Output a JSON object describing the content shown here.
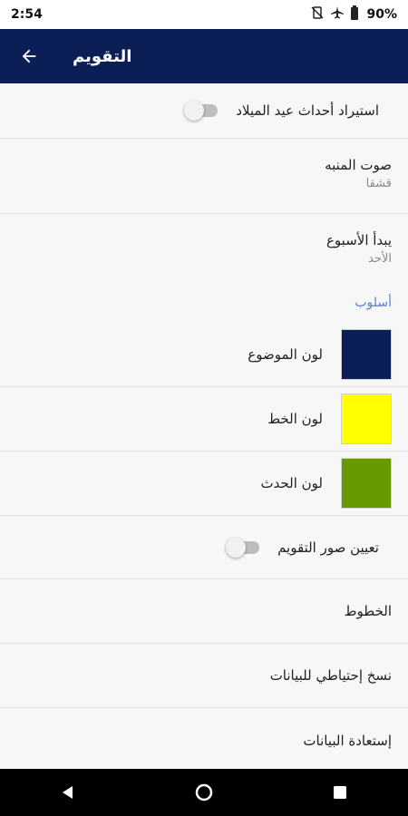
{
  "status_bar": {
    "time": "2:54",
    "battery": "90%",
    "icons": [
      "vibrate-off-icon",
      "airplane-icon",
      "battery-icon"
    ]
  },
  "app_bar": {
    "title": "التقويم",
    "back_icon": "arrow-back-icon"
  },
  "settings": {
    "import_christmas": {
      "label": "استيراد أحداث عيد الميلاد",
      "enabled": false
    },
    "alarm_sound": {
      "label": "صوت المنبه",
      "value": "قشقا"
    },
    "week_start": {
      "label": "يبدأ الأسبوع",
      "value": "الأحد"
    },
    "style_header": "أسلوب",
    "theme_color": {
      "label": "لون الموضوع",
      "color": "#0b1e55"
    },
    "font_color": {
      "label": "لون الخط",
      "color": "#ffff00"
    },
    "event_color": {
      "label": "لون الحدث",
      "color": "#669a00"
    },
    "calendar_images": {
      "label": "تعيين صور التقويم",
      "enabled": false
    },
    "fonts": {
      "label": "الخطوط"
    },
    "backup": {
      "label": "نسخ إحتياطي للبيانات"
    },
    "restore": {
      "label": "إستعادة البيانات"
    }
  },
  "nav_bar": {
    "buttons": [
      "back-icon",
      "home-icon",
      "recents-icon"
    ]
  }
}
